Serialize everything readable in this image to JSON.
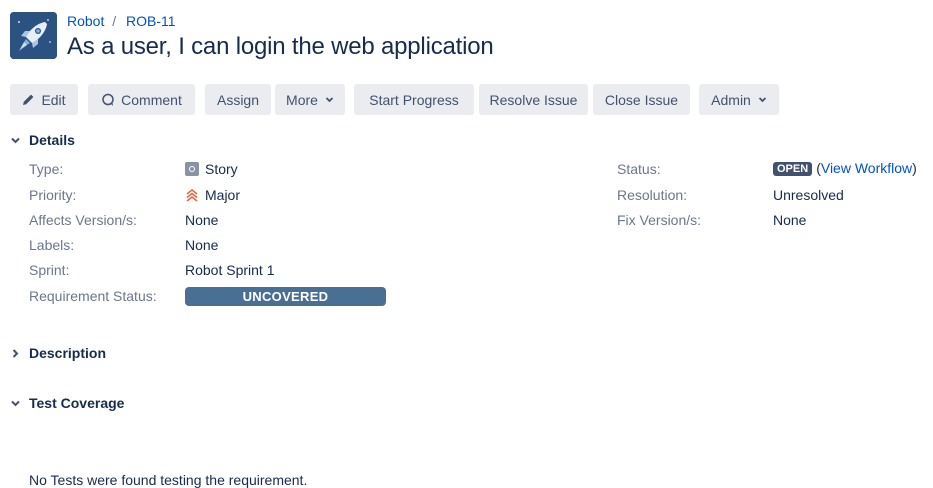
{
  "header": {
    "breadcrumb": {
      "project": "Robot",
      "separator": "/",
      "issue_key": "ROB-11"
    },
    "title": "As a user, I can login the web application",
    "project_avatar_icon": "rocket-icon"
  },
  "toolbar": {
    "edit": "Edit",
    "comment": "Comment",
    "assign": "Assign",
    "more": "More",
    "start_progress": "Start Progress",
    "resolve_issue": "Resolve Issue",
    "close_issue": "Close Issue",
    "admin": "Admin"
  },
  "details": {
    "heading": "Details",
    "left": [
      {
        "label": "Type:",
        "value": "Story",
        "icon": "story-icon"
      },
      {
        "label": "Priority:",
        "value": "Major",
        "icon": "priority-major-icon"
      },
      {
        "label": "Affects Version/s:",
        "value": "None"
      },
      {
        "label": "Labels:",
        "value": "None"
      },
      {
        "label": "Sprint:",
        "value": "Robot Sprint 1"
      },
      {
        "label": "Requirement Status:",
        "value": "UNCOVERED"
      }
    ],
    "right": [
      {
        "label": "Status:",
        "badge": "OPEN",
        "link_prefix": "(",
        "link": "View Workflow",
        "link_suffix": ")"
      },
      {
        "label": "Resolution:",
        "value": "Unresolved"
      },
      {
        "label": "Fix Version/s:",
        "value": "None"
      }
    ]
  },
  "description": {
    "heading": "Description"
  },
  "test_coverage": {
    "heading": "Test Coverage",
    "message": "No Tests were found testing the requirement."
  },
  "colors": {
    "link": "#0052cc",
    "button_bg": "#ebecf0",
    "requirement_bar": "#4a6f94",
    "status_lozenge": "#42526e",
    "priority_major": "#e5683f"
  }
}
